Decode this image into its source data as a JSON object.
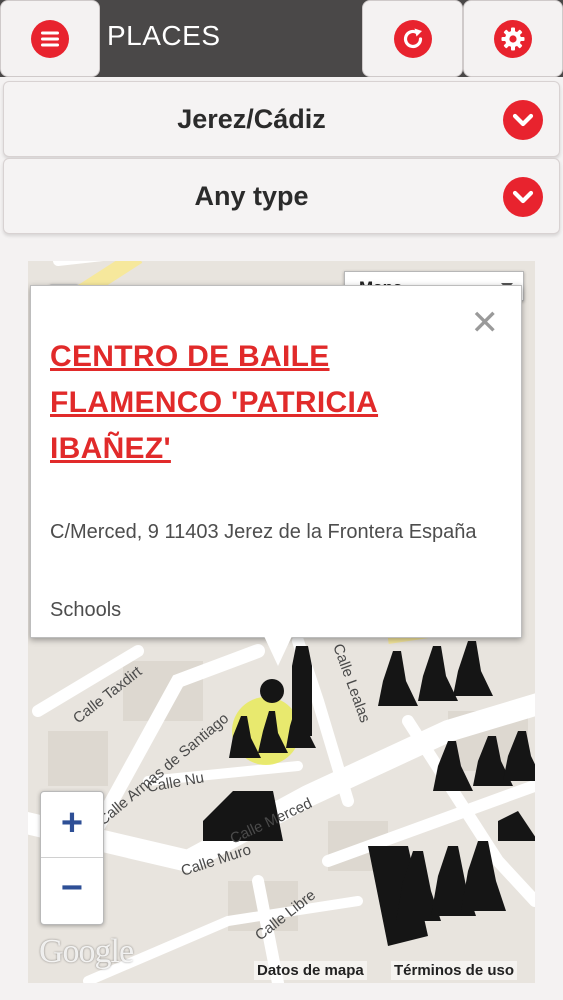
{
  "header": {
    "title": "PLACES",
    "menu_icon": "hamburger-menu-icon",
    "refresh_icon": "refresh-icon",
    "settings_icon": "gear-icon"
  },
  "filters": {
    "location": {
      "value": "Jerez/Cádiz",
      "icon": "chevron-down-icon"
    },
    "type": {
      "value": "Any type",
      "icon": "chevron-down-icon"
    }
  },
  "map": {
    "map_type": "Mapa",
    "zoom_in": "+",
    "zoom_out": "−",
    "logo": "Google",
    "attribution": "Datos de mapa",
    "terms": "Términos de uso",
    "streets": [
      "Calle Taxdirt",
      "Calle Armas de Santiago",
      "Calle Merced",
      "Calle Muro",
      "Calle Libre",
      "Calle Lealas",
      "Calle Nu"
    ]
  },
  "info_window": {
    "title": "CENTRO DE BAILE FLAMENCO 'PATRICIA IBAÑEZ'",
    "address": "C/Merced, 9 11403 Jerez de la Frontera España",
    "category": "Schools",
    "close_icon": "close-icon"
  },
  "colors": {
    "accent": "#e8232e",
    "header_bg": "#4a4848",
    "link": "#e12a2a"
  }
}
